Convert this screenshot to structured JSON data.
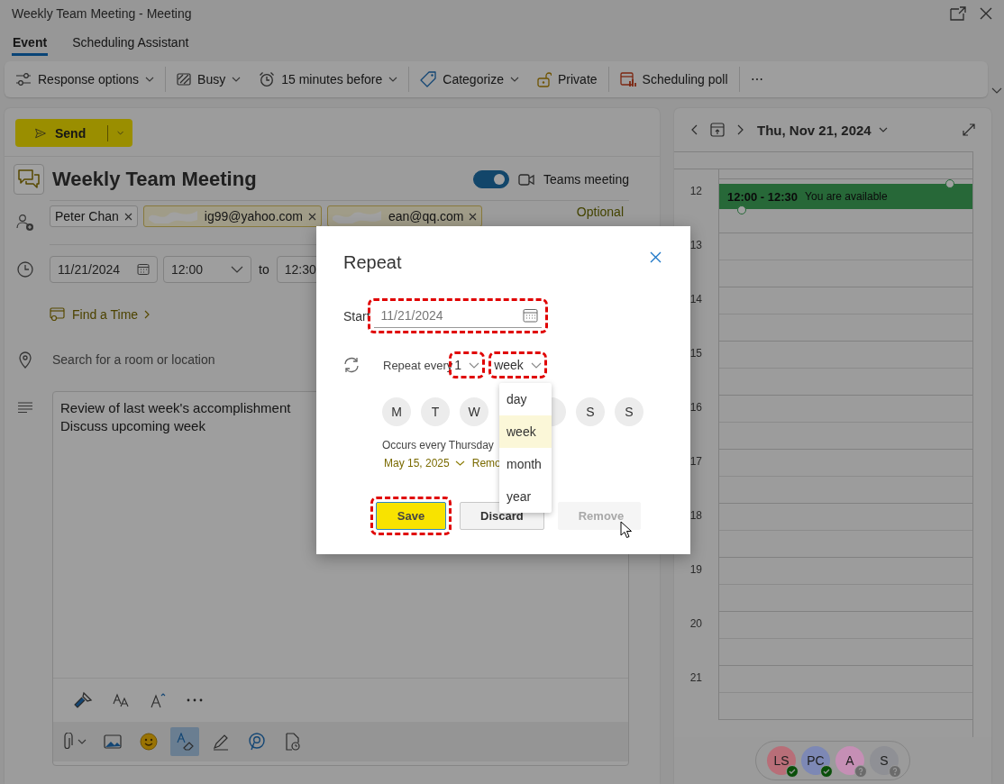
{
  "window": {
    "title": "Weekly Team Meeting - Meeting"
  },
  "tabs": [
    {
      "label": "Event",
      "selected": true
    },
    {
      "label": "Scheduling Assistant",
      "selected": false
    }
  ],
  "toolbar": [
    [
      {
        "label": "Response options",
        "dropdown": true
      }
    ],
    [
      {
        "label": "Busy",
        "dropdown": true
      },
      {
        "label": "15 minutes before",
        "dropdown": true
      }
    ],
    [
      {
        "label": "Categorize",
        "dropdown": true
      },
      {
        "label": "Private",
        "dropdown": false
      }
    ],
    [
      {
        "label": "Scheduling poll",
        "dropdown": false
      }
    ],
    [
      {
        "label": "⋯",
        "dropdown": false
      }
    ]
  ],
  "send_button": {
    "label": "Send"
  },
  "meeting": {
    "title": "Weekly Team Meeting",
    "teams_meeting": {
      "label": "Teams meeting",
      "on": true
    },
    "attendees": [
      {
        "name": "Peter Chan",
        "external": false
      },
      {
        "name": "ig99@yahoo.com",
        "external": true
      },
      {
        "name": "ean@qq.com",
        "external": true
      }
    ],
    "optional_label": "Optional",
    "date": "11/21/2024",
    "start_time": "12:00",
    "to_label": "to",
    "end_time": "12:30",
    "find_time": "Find a Time",
    "location": {
      "placeholder": "Search for a room or location"
    },
    "body": [
      "Review of last week's accomplishment",
      "Discuss upcoming week"
    ],
    "insert_tools": [
      {
        "active": false
      },
      {
        "active": false
      },
      {
        "active": false
      },
      {
        "active": true
      },
      {
        "active": false
      },
      {
        "active": false
      },
      {
        "active": false
      }
    ]
  },
  "calendar": {
    "date": "Thu, Nov 21, 2024",
    "hours": [
      "12",
      "13",
      "14",
      "15",
      "16",
      "17",
      "18",
      "19",
      "20",
      "21"
    ],
    "event": {
      "time": "12:00 - 12:30",
      "note": "You are available"
    },
    "attendees": [
      {
        "initials": "LS",
        "color": "#b86e78",
        "accepted": true
      },
      {
        "initials": "PC",
        "color": "#7d88b5",
        "accepted": true
      },
      {
        "initials": "A",
        "color": "#c58fb5",
        "accepted": false
      },
      {
        "initials": "S",
        "color": "#8f9095",
        "accepted": false
      }
    ]
  },
  "dialog": {
    "title": "Repeat",
    "start_label": "Start",
    "start_date": "11/21/2024",
    "start_outlined": true,
    "repeat_label": "Repeat every",
    "interval": "1",
    "interval_outlined": true,
    "unit": "week",
    "unit_outlined": true,
    "unit_options": [
      {
        "label": "day",
        "selected": false
      },
      {
        "label": "week",
        "selected": true
      },
      {
        "label": "month",
        "selected": false
      },
      {
        "label": "year",
        "selected": false
      }
    ],
    "days": [
      {
        "label": "M",
        "selected": false
      },
      {
        "label": "T",
        "selected": false
      },
      {
        "label": "W",
        "selected": false
      },
      {
        "selected": false
      },
      {
        "label": "S",
        "selected": false
      },
      {
        "label": "S",
        "selected": false
      }
    ],
    "summary": "Occurs every Thursday",
    "end_date": "May 15, 2025",
    "remove_link": "Remo",
    "buttons": [
      {
        "label": "Save",
        "kind": "primary",
        "disabled": false,
        "outlined": true
      },
      {
        "label": "Discard",
        "kind": "default",
        "disabled": false,
        "outlined": false
      },
      {
        "label": "Remove",
        "kind": "default",
        "disabled": true,
        "outlined": false
      }
    ]
  }
}
